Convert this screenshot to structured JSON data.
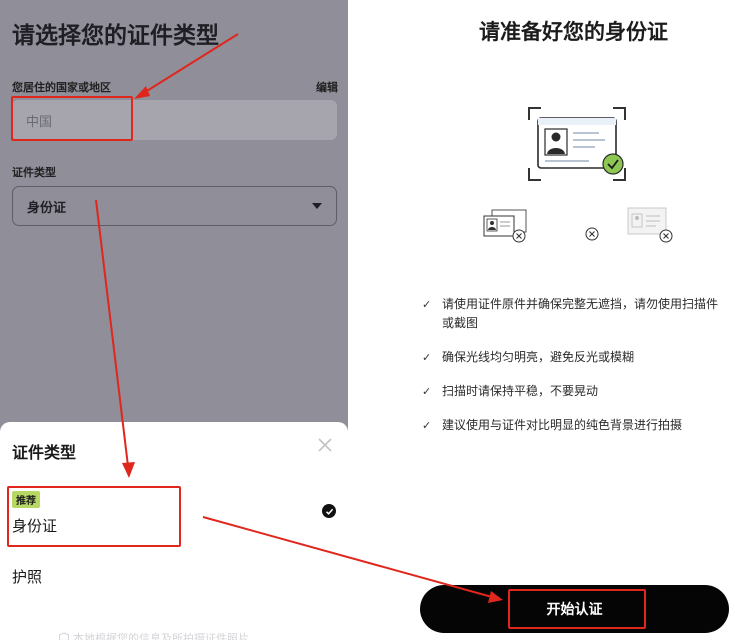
{
  "left": {
    "title": "请选择您的证件类型",
    "country_label": "您居住的国家或地区",
    "edit_label": "编辑",
    "country_value": "中国",
    "doc_type_label": "证件类型",
    "doc_type_value": "身份证"
  },
  "sheet": {
    "title": "证件类型",
    "options": [
      {
        "badge": "推荐",
        "label": "身份证",
        "selected": true
      },
      {
        "label": "护照",
        "selected": false
      }
    ],
    "footer_note": "本地根据您的信息及所拍摄证件照片"
  },
  "right": {
    "title": "请准备好您的身份证",
    "tips": [
      "请使用证件原件并确保完整无遮挡，请勿使用扫描件或截图",
      "确保光线均匀明亮，避免反光或模糊",
      "扫描时请保持平稳，不要晃动",
      "建议使用与证件对比明显的纯色背景进行拍摄"
    ],
    "start_button": "开始认证"
  },
  "colors": {
    "overlay_gray": "#8f8e99",
    "badge_green": "#b7d964",
    "success_green": "#8dc653",
    "annotation_red": "#e0271d",
    "button_black": "#050505"
  }
}
